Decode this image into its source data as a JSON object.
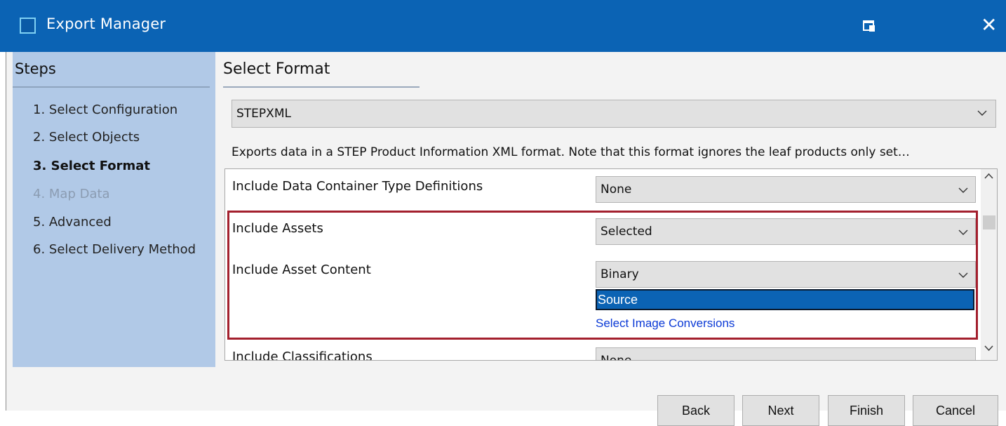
{
  "window": {
    "title": "Export Manager",
    "accent_color": "#0b63b4",
    "icons": {
      "app": "app-window-icon",
      "restore": "restore-window-icon",
      "close": "close-icon"
    },
    "close_glyph": "✕"
  },
  "steps": {
    "heading": "Steps",
    "items": [
      {
        "label": "1. Select Configuration",
        "state": "normal"
      },
      {
        "label": "2. Select Objects",
        "state": "normal"
      },
      {
        "label": "3. Select Format",
        "state": "current"
      },
      {
        "label": "4. Map Data",
        "state": "disabled"
      },
      {
        "label": "5. Advanced",
        "state": "normal"
      },
      {
        "label": "6. Select Delivery Method",
        "state": "normal"
      }
    ]
  },
  "content": {
    "heading": "Select Format",
    "format_select": {
      "value": "STEPXML"
    },
    "description": "Exports data in a STEP Product Information XML format. Note that this format ignores the leaf products only set…",
    "options": [
      {
        "label": "Include Data Container Type Definitions",
        "value": "None"
      },
      {
        "label": "Include Assets",
        "value": "Selected"
      },
      {
        "label": "Include Asset Content",
        "value": "Binary"
      },
      {
        "label": "Include Classifications",
        "value": "None"
      }
    ],
    "asset_content_dropdown": {
      "highlighted_option": "Source",
      "link": "Select Image Conversions"
    },
    "highlight_color": "#a3202e"
  },
  "buttons": {
    "back": "Back",
    "next": "Next",
    "finish": "Finish",
    "cancel": "Cancel"
  }
}
